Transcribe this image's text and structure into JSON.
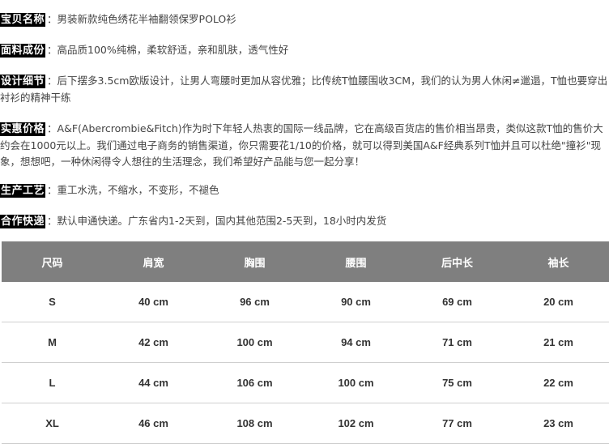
{
  "info": [
    {
      "label": "宝贝名称",
      "text": "男装新款纯色绣花半袖翻领保罗POLO衫"
    },
    {
      "label": "面料成份",
      "text": "高品质100%纯棉，柔软舒适，亲和肌肤，透气性好"
    },
    {
      "label": "设计细节",
      "text": "后下摆多3.5cm欧版设计，让男人弯腰时更加从容优雅；比传统T恤腰围收3CM，我们的认为男人休闲≠邋遢，T恤也要穿出衬衫的精神干练"
    },
    {
      "label": "实惠价格",
      "text": "A&F(Abercrombie&Fitch)作为时下年轻人热衷的国际一线品牌，它在高级百货店的售价相当昂贵，类似这款T恤的售价大约会在1000元以上。我们通过电子商务的销售渠道，你只需要花1/10的价格，就可以得到美国A&F经典系列T恤并且可以杜绝\"撞衫\"现象，想想吧，一种休闲得令人想往的生活理念，我们希望好产品能与您一起分享！"
    },
    {
      "label": "生产工艺",
      "text": "重工水洗，不缩水，不变形，不褪色"
    },
    {
      "label": "合作快递",
      "text": "默认申通快递。广东省内1-2天到，国内其他范围2-5天到，18小时内发货"
    }
  ],
  "separator": "：",
  "table": {
    "headers": [
      "尺码",
      "肩宽",
      "胸围",
      "腰围",
      "后中长",
      "袖长"
    ],
    "rows": [
      [
        "S",
        "40 cm",
        "96 cm",
        "90 cm",
        "69 cm",
        "20 cm"
      ],
      [
        "M",
        "42 cm",
        "100 cm",
        "94 cm",
        "71 cm",
        "21 cm"
      ],
      [
        "L",
        "44 cm",
        "106 cm",
        "100 cm",
        "75 cm",
        "22 cm"
      ],
      [
        "XL",
        "46 cm",
        "108 cm",
        "102 cm",
        "77 cm",
        "23 cm"
      ]
    ]
  }
}
